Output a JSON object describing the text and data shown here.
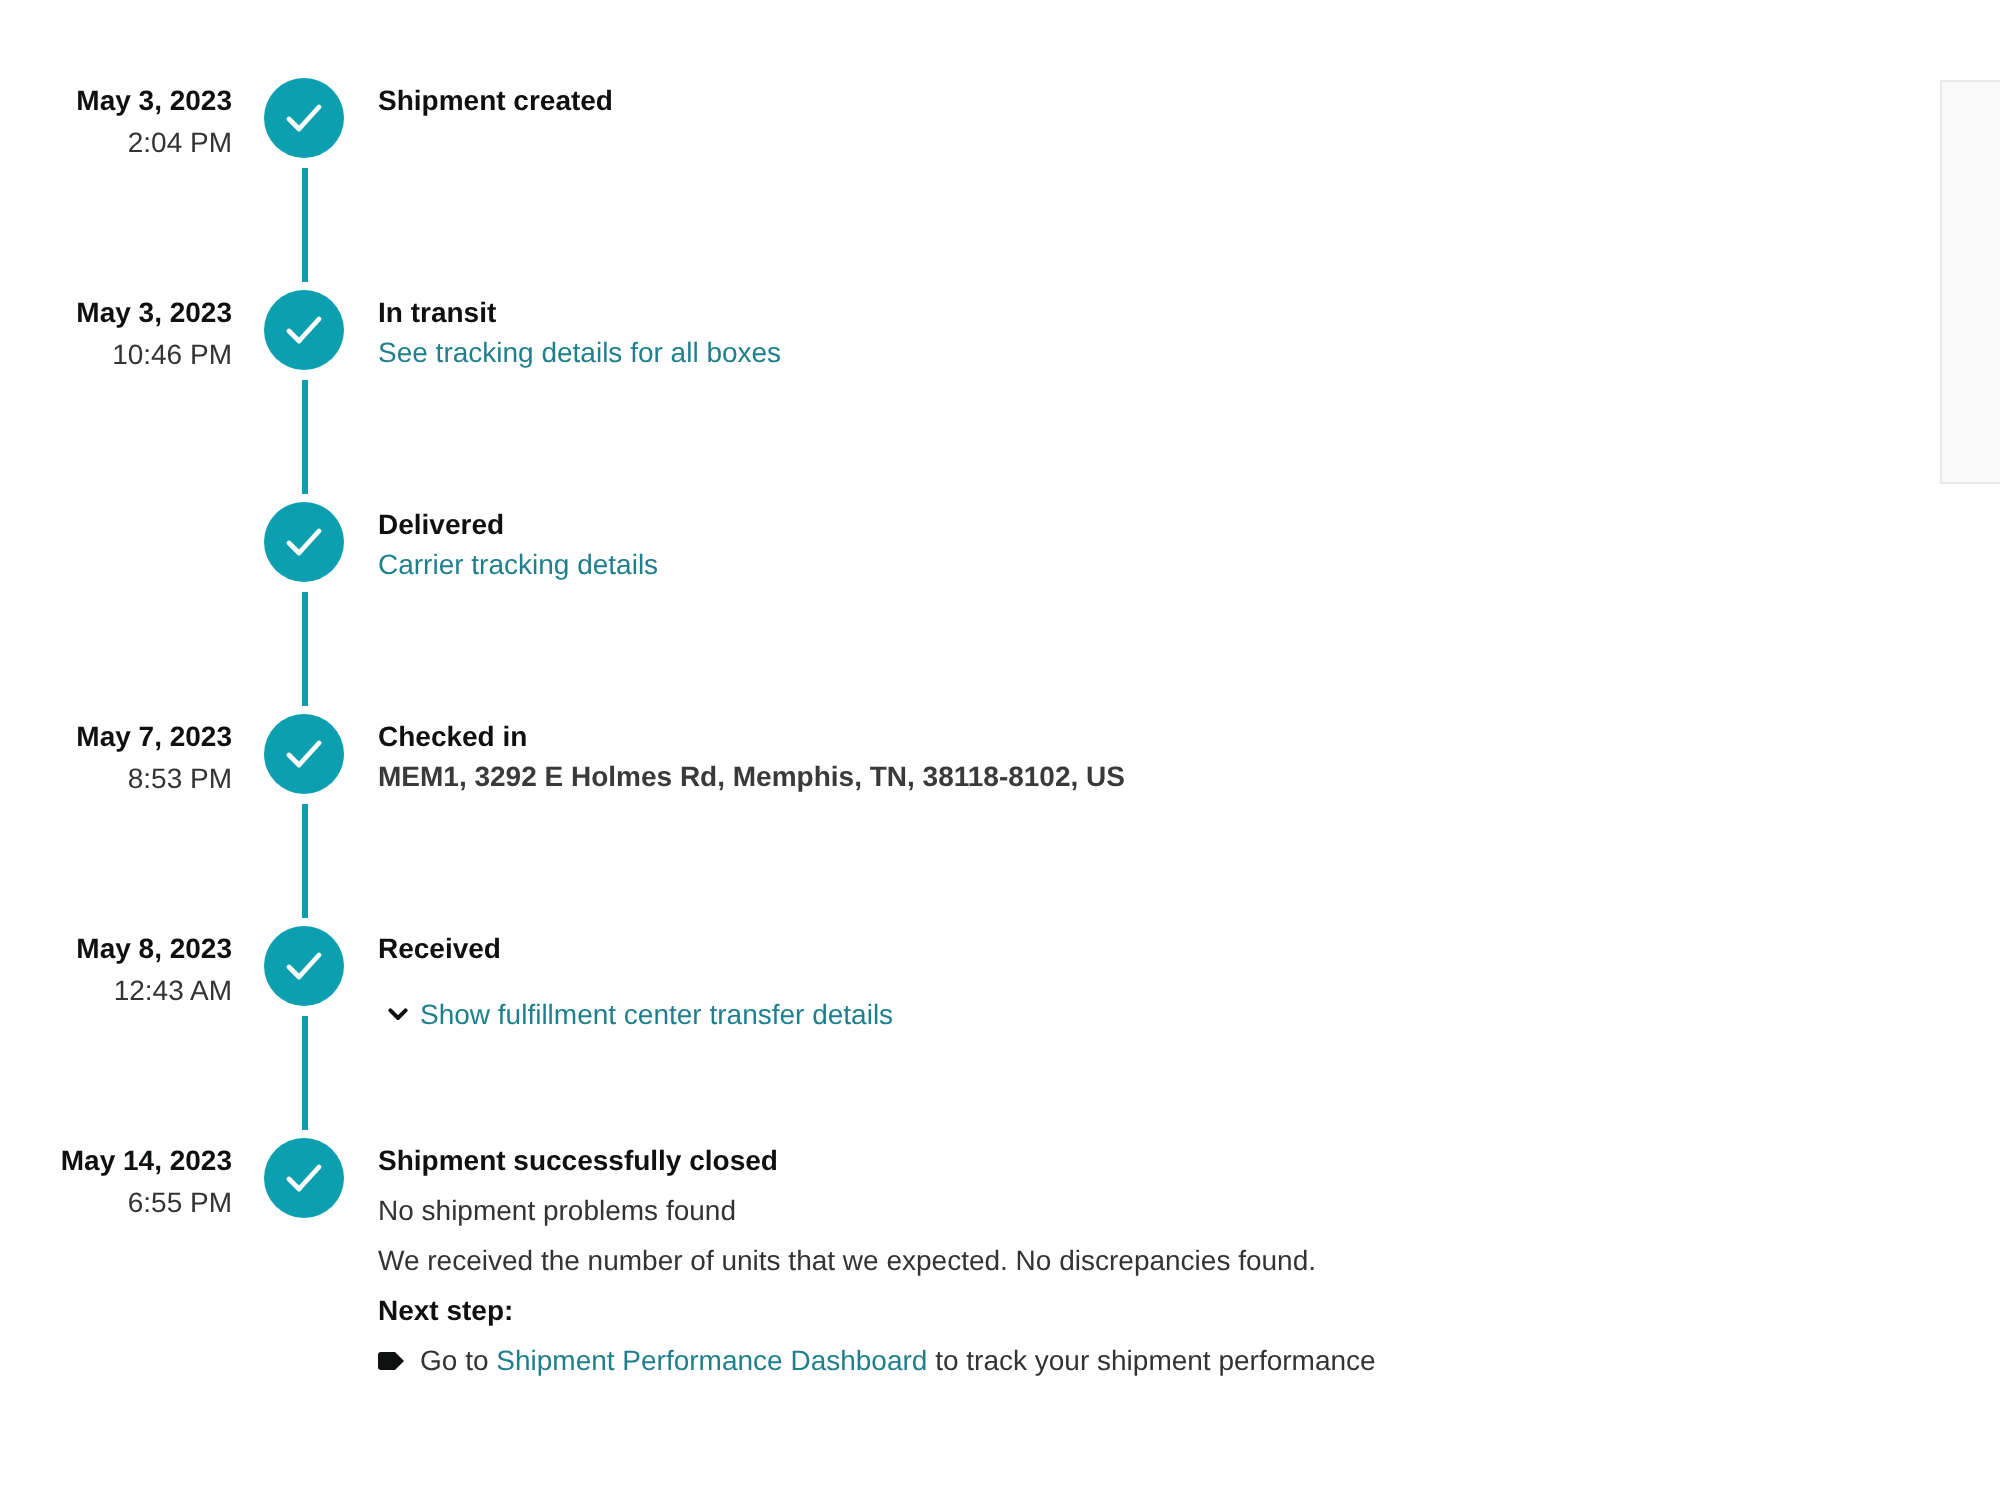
{
  "events": [
    {
      "date": "May 3, 2023",
      "time": "2:04 PM",
      "title": "Shipment created",
      "completed": true
    },
    {
      "date": "May 3, 2023",
      "time": "10:46 PM",
      "title": "In transit",
      "completed": true,
      "details": [
        {
          "kind": "link",
          "text": "See tracking details for all boxes"
        }
      ]
    },
    {
      "title": "Delivered",
      "completed": true,
      "details": [
        {
          "kind": "link",
          "text": "Carrier tracking details"
        }
      ]
    },
    {
      "date": "May 7, 2023",
      "time": "8:53 PM",
      "title": "Checked in",
      "completed": true,
      "details": [
        {
          "kind": "address",
          "text": "MEM1, 3292 E Holmes Rd, Memphis, TN, 38118-8102, US"
        }
      ]
    },
    {
      "date": "May 8, 2023",
      "time": "12:43 AM",
      "title": "Received",
      "completed": true,
      "details": [
        {
          "kind": "toggle",
          "text": "Show fulfillment center transfer details",
          "expanded": false
        }
      ]
    },
    {
      "date": "May 14, 2023",
      "time": "6:55 PM",
      "title": "Shipment successfully closed",
      "completed": true,
      "details": [
        {
          "kind": "text",
          "text": "No shipment problems found"
        },
        {
          "kind": "text",
          "text": "We received the number of units that we expected. No discrepancies found."
        },
        {
          "kind": "heading",
          "text": "Next step:"
        },
        {
          "kind": "bullet",
          "before": "Go to",
          "link": "Shipment Performance Dashboard",
          "after": "to track your shipment performance"
        }
      ]
    }
  ]
}
